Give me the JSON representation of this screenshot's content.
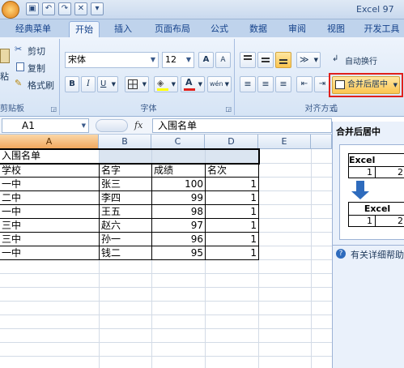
{
  "title_bar": {
    "title": "Excel 97"
  },
  "quick_access": [
    "save-icon",
    "undo-icon",
    "redo-icon",
    "tool-icon",
    "dropdown-icon"
  ],
  "tabs": [
    "经典菜单",
    "开始",
    "插入",
    "页面布局",
    "公式",
    "数据",
    "审阅",
    "视图",
    "开发工具"
  ],
  "active_tab": "开始",
  "clipboard": {
    "paste_label": "粘",
    "cut": "剪切",
    "copy": "复制",
    "format_painter": "格式刷",
    "group_label": "剪贴板"
  },
  "font": {
    "name": "宋体",
    "size": "12",
    "group_label": "字体",
    "bold": "B",
    "italic": "I",
    "underline": "U",
    "grow": "A",
    "shrink": "A",
    "color_letter": "A",
    "phonetic": "wén"
  },
  "alignment": {
    "wrap_text": "自动换行",
    "merge_center": "合并后居中",
    "group_label": "对齐方式"
  },
  "formula_bar": {
    "name_box": "A1",
    "fx": "fx",
    "content": "入围名单"
  },
  "columns": [
    "A",
    "B",
    "C",
    "D",
    "E"
  ],
  "sheet": {
    "title": "入围名单",
    "headers": [
      "学校",
      "名字",
      "成绩",
      "名次"
    ],
    "rows": [
      [
        "一中",
        "张三",
        "100",
        "1"
      ],
      [
        "二中",
        "李四",
        "99",
        "1"
      ],
      [
        "一中",
        "王五",
        "98",
        "1"
      ],
      [
        "三中",
        "赵六",
        "97",
        "1"
      ],
      [
        "三中",
        "孙一",
        "96",
        "1"
      ],
      [
        "一中",
        "钱二",
        "95",
        "1"
      ]
    ]
  },
  "tooltip_pane": {
    "title": "合并后居中",
    "before_label": "Excel",
    "before_values": [
      "1",
      "2"
    ],
    "after_label": "Excel",
    "after_values": [
      "1",
      "2"
    ],
    "help_text": "有关详细帮助"
  },
  "colors": {
    "selected_header": "#f1a85e",
    "highlight_box": "#e0201c",
    "ribbon": "#d6e4f5"
  }
}
